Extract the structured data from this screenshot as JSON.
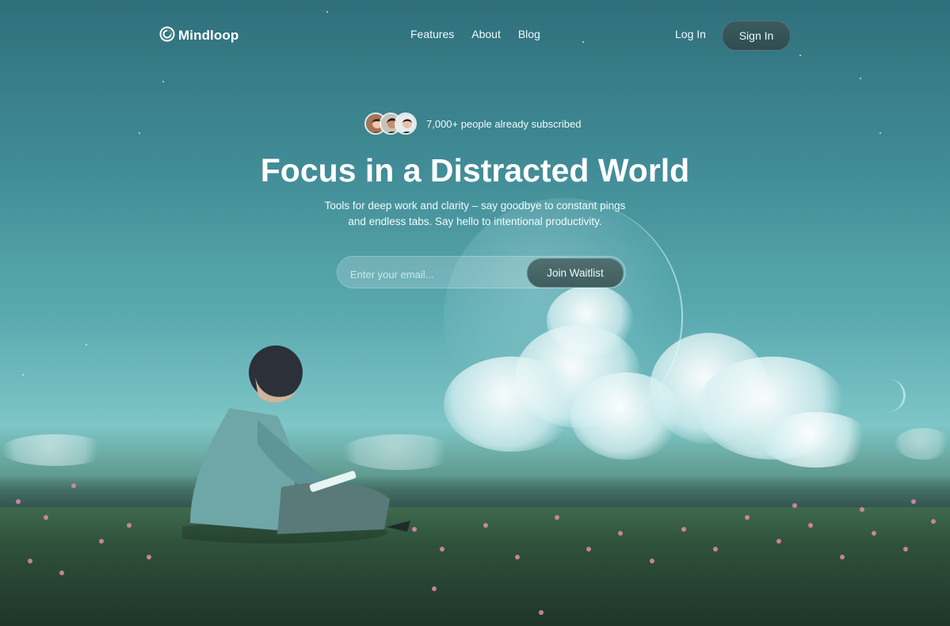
{
  "header": {
    "brand": "Mindloop",
    "nav": [
      "Features",
      "About",
      "Blog"
    ],
    "login": "Log In",
    "signin": "Sign In"
  },
  "hero": {
    "social_proof": "7,000+ people already subscribed",
    "title": "Focus in a Distracted World",
    "subtitle_line1": "Tools for deep work and clarity – say goodbye to constant pings",
    "subtitle_line2": "and endless tabs. Say hello to intentional productivity.",
    "email_placeholder": "Enter your email...",
    "cta": "Join Waitlist"
  },
  "icons": {
    "logo": "spiral-logo-icon"
  },
  "colors": {
    "text": "#ffffff",
    "button_dark": "#2f4d50",
    "sky_top": "#2f6f7c",
    "sky_mid": "#5aa9b0",
    "meadow": "#2f523b",
    "flowers": "#d98aa0"
  }
}
